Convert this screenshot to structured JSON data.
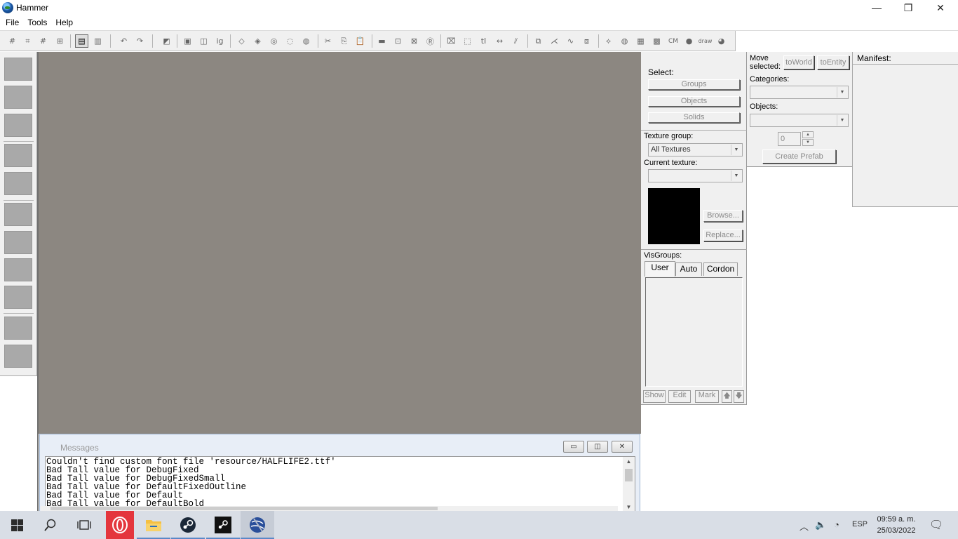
{
  "window": {
    "title": "Hammer",
    "minimize_glyph": "—",
    "restore_glyph": "❐",
    "close_glyph": "✕"
  },
  "menu": [
    "File",
    "Tools",
    "Help"
  ],
  "toolbar": {
    "icons": [
      "grid-toggle",
      "grid-3d",
      "grid-dots",
      "grid-minus",
      "grid-plus",
      "texture-lock",
      "texture-lock-scale",
      "undo",
      "redo",
      "carve",
      "group",
      "ungroup",
      "ignore-groups",
      "hide-selected",
      "hide-unselected",
      "show-all",
      "select-all",
      "cut",
      "copy",
      "paste",
      "toggle-solid",
      "tie-to-entity",
      "move-to-world",
      "radius-culling",
      "snap-to-grid",
      "select-box",
      "transform",
      "align",
      "flip",
      "cordon",
      "split",
      "smooth",
      "merge",
      "displacement",
      "sphere",
      "texture-apply",
      "quick-hide",
      "cm",
      "decal",
      "draw",
      "entity-report"
    ],
    "cm_label": "CM",
    "draw_label": "draw"
  },
  "select_panel": {
    "label": "Select:",
    "groups": "Groups",
    "objects": "Objects",
    "solids": "Solids"
  },
  "texture_panel": {
    "group_label": "Texture group:",
    "group_value": "All Textures",
    "current_label": "Current texture:",
    "current_value": "",
    "browse": "Browse...",
    "replace": "Replace..."
  },
  "visgroups": {
    "label": "VisGroups:",
    "tabs": [
      "User",
      "Auto",
      "Cordon"
    ],
    "active_tab": "User",
    "show": "Show",
    "edit": "Edit",
    "mark": "Mark",
    "up_glyph": "🡅",
    "down_glyph": "🡇"
  },
  "objects_panel": {
    "move_label_1": "Move",
    "move_label_2": "selected:",
    "to_world": "toWorld",
    "to_entity": "toEntity",
    "categories_label": "Categories:",
    "objects_label": "Objects:",
    "spin_value": "0",
    "create_prefab": "Create Prefab"
  },
  "manifest": {
    "label": "Manifest:"
  },
  "messages": {
    "title": "Messages",
    "lines": [
      "Couldn't find custom font file 'resource/HALFLIFE2.ttf'",
      "Bad Tall value for DebugFixed",
      "Bad Tall value for DebugFixedSmall",
      "Bad Tall value for DefaultFixedOutline",
      "Bad Tall value for Default",
      "Bad Tall value for DefaultBold"
    ]
  },
  "taskbar": {
    "language": "ESP",
    "time": "09:59 a. m.",
    "date": "25/03/2022",
    "colors": {
      "opera": "#e4363d",
      "explorer": "#f5c042",
      "steam": "#1b2838"
    }
  }
}
